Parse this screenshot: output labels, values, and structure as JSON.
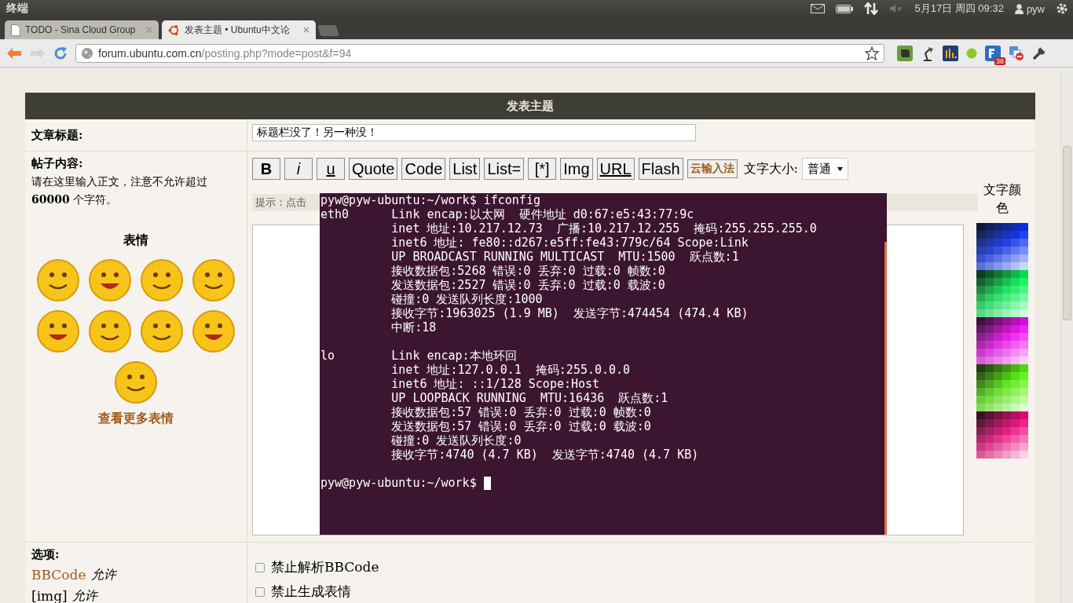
{
  "top_panel": {
    "title": "终端",
    "clock": "5月17日 周四 09:32",
    "user": "pyw"
  },
  "browser": {
    "tabs": [
      {
        "label": "TODO - Sina Cloud Group",
        "selected": false
      },
      {
        "label": "发表主题 • Ubuntu中文论",
        "selected": true
      }
    ],
    "address": {
      "domain": "forum.ubuntu.com.cn",
      "path": "/posting.php?mode=post&f=94"
    },
    "extension_badge": "38"
  },
  "form": {
    "header": "发表主题",
    "subject_label": "文章标题:",
    "subject_value": "标题栏没了！另一种没！",
    "content_label": "帖子内容:",
    "content_hint": "请在这里输入正文，注意不允许超过 **60000** 个字符。",
    "smilies_title": "表情",
    "more_smilies": "查看更多表情",
    "buttons": [
      {
        "label": "B",
        "kind": "bold"
      },
      {
        "label": "i",
        "kind": "italic"
      },
      {
        "label": "u",
        "kind": "underline"
      },
      {
        "label": "Quote",
        "kind": "plain"
      },
      {
        "label": "Code",
        "kind": "plain"
      },
      {
        "label": "List",
        "kind": "plain"
      },
      {
        "label": "List=",
        "kind": "plain"
      },
      {
        "label": "[*]",
        "kind": "plain"
      },
      {
        "label": "Img",
        "kind": "plain"
      },
      {
        "label": "URL",
        "kind": "underline"
      },
      {
        "label": "Flash",
        "kind": "plain"
      },
      {
        "label": "云输入法",
        "kind": "ime"
      }
    ],
    "font_size_label": "文字大小:",
    "font_size_value": "普通",
    "tip": "提示：点击",
    "color_label": "文字颜色",
    "options_label": "选项:",
    "options": [
      {
        "name": "BBCode",
        "kind": "link",
        "status": "允许"
      },
      {
        "name": "[img]",
        "kind": "plain",
        "status": "允许"
      }
    ],
    "checkboxes": [
      {
        "label": "禁止解析BBCode",
        "checked": false
      },
      {
        "label": "禁止生成表情",
        "checked": false
      }
    ]
  },
  "terminal": {
    "lines": [
      "pyw@pyw-ubuntu:~/work$ ifconfig",
      "eth0      Link encap:以太网  硬件地址 d0:67:e5:43:77:9c",
      "          inet 地址:10.217.12.73  广播:10.217.12.255  掩码:255.255.255.0",
      "          inet6 地址: fe80::d267:e5ff:fe43:779c/64 Scope:Link",
      "          UP BROADCAST RUNNING MULTICAST  MTU:1500  跃点数:1",
      "          接收数据包:5268 错误:0 丢弃:0 过载:0 帧数:0",
      "          发送数据包:2527 错误:0 丢弃:0 过载:0 载波:0",
      "          碰撞:0 发送队列长度:1000",
      "          接收字节:1963025 (1.9 MB)  发送字节:474454 (474.4 KB)",
      "          中断:18",
      "lo        Link encap:本地环回",
      "          inet 地址:127.0.0.1  掩码:255.0.0.0",
      "          inet6 地址: ::1/128 Scope:Host",
      "          UP LOOPBACK RUNNING  MTU:16436  跃点数:1",
      "          接收数据包:57 错误:0 丢弃:0 过载:0 帧数:0",
      "          发送数据包:57 错误:0 丢弃:0 过载:0 载波:0",
      "          碰撞:0 发送队列长度:0",
      "          接收字节:4740 (4.7 KB)  发送字节:4740 (4.7 KB)"
    ],
    "prompt": "pyw@pyw-ubuntu:~/work$"
  }
}
